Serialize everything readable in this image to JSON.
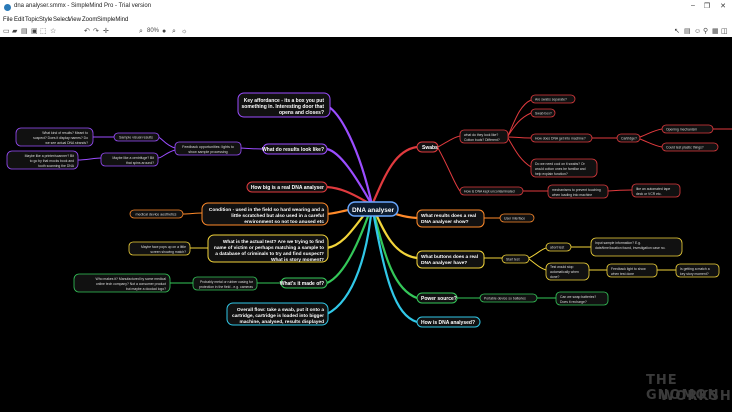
{
  "window": {
    "title": "dna analyser.smmx - SimpleMind Pro - Trial version",
    "min": "–",
    "max": "❐",
    "close": "✕"
  },
  "menu": [
    "File",
    "Edit",
    "Topic",
    "Style",
    "Select",
    "View",
    "Zoom",
    "SimpleMind"
  ],
  "toolbar": {
    "zoom": "80%"
  },
  "map": {
    "center": "DNA analyser",
    "nodes": {
      "affordance": [
        "Key affordance - its a box you put",
        "something in. Interesting door that",
        "opens and closes?"
      ],
      "results_look": "What do results look like?",
      "feedback": [
        "Feedback opportunities: lights to",
        "show sample processing"
      ],
      "sample_visual": "Sample visual results",
      "what_kind": [
        "What kind of results? Meant to",
        "suspect? Does it display names? Do",
        "we see actual DNA strands?"
      ],
      "maybe_printer": [
        "Maybe like a printer/scanner? Bit",
        "to go by that mocks book and",
        "tooth scanning the DNA"
      ],
      "maybe_centrifuge": [
        "Maybe like a centrifuge? Bit",
        "that spins around?"
      ],
      "how_big": "How big is a real DNA analyser",
      "condition": [
        "Condition - used in the field so hard wearing and a",
        "little scratched but also used in a careful",
        "environment so not too anused etc"
      ],
      "medical": "medical device aesthetics",
      "actual_test": [
        "What is the actual test? Are we trying to find",
        "name of victim or perhaps matching a sample to",
        "a database of criminals to try and find suspect?",
        "What is story moment?"
      ],
      "maybe_face": [
        "Maybe face pops up on a little",
        "screen showing match?"
      ],
      "made_of": "What's it made of?",
      "probably_metal": [
        "Probably metal or rubber casing for",
        "protection in the field - e.g. cameras"
      ],
      "who_makes": [
        "Who makes it? Manufactured by some medical",
        "online tech company? Not a consumer product",
        "but maybe a doodad logo?"
      ],
      "overall": [
        "Overall flow: take a swab, put it onto a",
        "cartridge, cartridge is loaded into bigger",
        "machine, analysed, results displayed"
      ],
      "swabs": "Swabs",
      "what_do_look": [
        "what do they look like?",
        "Cotton buds? Different?"
      ],
      "are_swabs": "Are swabs separate?",
      "swab_box": "Swab box?",
      "how_dna": "How does DNA get into machine?",
      "cartridge": "Cartridge?",
      "opening": "Opening mechanism",
      "could_plastic": "Could test plastic things?",
      "do_we_need": [
        "Do we need cool on it swabs? Or",
        "would cotton ones be familiar and",
        "help explain function?"
      ],
      "how_dna_kept": "How is DNA kept uncontaminated",
      "mechanisms": [
        "mechanisms to prevent touching",
        "when loading into machine"
      ],
      "automated": [
        "like an automated tape",
        "deck or VCR etc."
      ],
      "what_results": [
        "What results does a real",
        "DNA analyser show?"
      ],
      "user_interface": "User interface",
      "what_buttons": [
        "What buttons does a real",
        "DNA analyser have?"
      ],
      "start_test": "Start test",
      "abort": "abort test",
      "input_sample": [
        "Input sample information? E.g.",
        "date/time/location found, investigation case no."
      ],
      "test_stop": [
        "Test would stop",
        "automatically when",
        "done?"
      ],
      "feedback_light": [
        "Feedback light to show",
        "when test done"
      ],
      "getting_match": [
        "Is getting a match a",
        "key story moment?"
      ],
      "power": "Power source?",
      "portable": "Portable device so batteries",
      "can_we": [
        "Can we swap batteries?",
        "Does it recharge?"
      ],
      "how_analysed": "How is DNA analysed?"
    }
  },
  "watermark": {
    "line1": "THE GNOMON",
    "line2": "WORKSHOP"
  },
  "colors": {
    "purple": "#9b4dff",
    "red": "#e03a3e",
    "orange": "#ff8a2a",
    "yellow": "#f2d43a",
    "green": "#34c759",
    "cyan": "#31c8e8",
    "blue": "#3b6bff",
    "center": "#6aa8ff"
  }
}
